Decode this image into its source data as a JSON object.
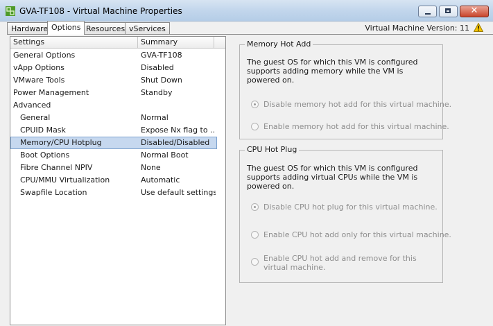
{
  "window": {
    "title": "GVA-TF108 - Virtual Machine Properties",
    "close_glyph": "✕"
  },
  "tabs": [
    {
      "label": "Hardware",
      "active": false
    },
    {
      "label": "Options",
      "active": true
    },
    {
      "label": "Resources",
      "active": false
    },
    {
      "label": "vServices",
      "active": false
    }
  ],
  "version_text": "Virtual Machine Version: 11",
  "settings_list": {
    "columns": [
      "Settings",
      "Summary"
    ],
    "rows": [
      {
        "setting": "General Options",
        "summary": "GVA-TF108"
      },
      {
        "setting": "vApp Options",
        "summary": "Disabled"
      },
      {
        "setting": "VMware Tools",
        "summary": "Shut Down"
      },
      {
        "setting": "Power Management",
        "summary": "Standby"
      },
      {
        "setting": "Advanced",
        "summary": ""
      },
      {
        "setting": "General",
        "summary": "Normal"
      },
      {
        "setting": "CPUID Mask",
        "summary": "Expose Nx flag to ..."
      },
      {
        "setting": "Memory/CPU Hotplug",
        "summary": "Disabled/Disabled"
      },
      {
        "setting": "Boot Options",
        "summary": "Normal Boot"
      },
      {
        "setting": "Fibre Channel NPIV",
        "summary": "None"
      },
      {
        "setting": "CPU/MMU Virtualization",
        "summary": "Automatic"
      },
      {
        "setting": "Swapfile Location",
        "summary": "Use default settings"
      }
    ]
  },
  "memory_hot_add": {
    "title": "Memory Hot Add",
    "description": "The guest OS for which this VM is configured supports adding memory while the VM is powered on.",
    "options": [
      {
        "label": "Disable memory hot add for this virtual machine.",
        "checked": true
      },
      {
        "label": "Enable memory hot add for this virtual machine.",
        "checked": false
      }
    ]
  },
  "cpu_hot_plug": {
    "title": "CPU Hot Plug",
    "description": "The guest OS for which this VM is configured supports adding virtual CPUs while the VM is powered on.",
    "options": [
      {
        "label": "Disable CPU hot plug for this virtual machine.",
        "checked": true
      },
      {
        "label": "Enable CPU hot add only for this virtual machine.",
        "checked": false
      },
      {
        "label": "Enable CPU hot add and remove for this virtual machine.",
        "checked": false
      }
    ]
  },
  "colors": {
    "title_bar": "#c2d6ec",
    "selection": "#c6d8ef",
    "close_button": "#c9452c",
    "warning": "#f5c400"
  }
}
